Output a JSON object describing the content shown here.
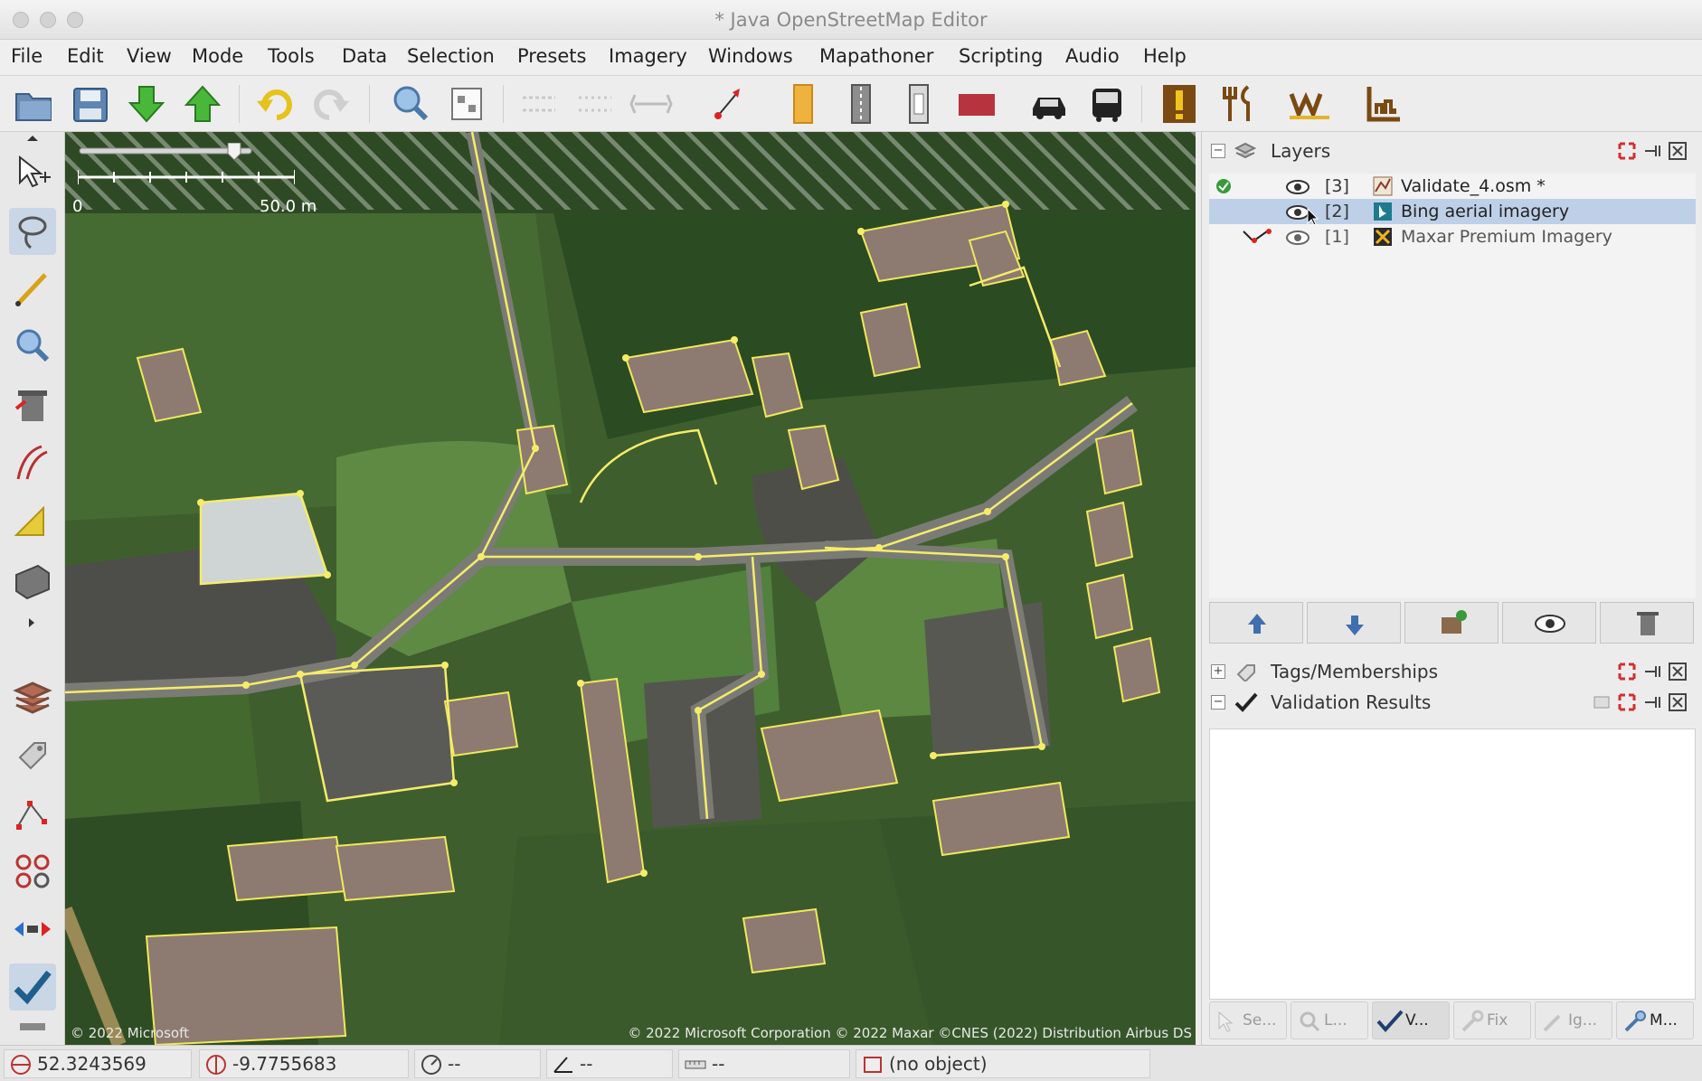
{
  "window": {
    "title": "* Java OpenStreetMap Editor"
  },
  "menu": [
    "File",
    "Edit",
    "View",
    "Mode",
    "Tools",
    "Data",
    "Selection",
    "Presets",
    "Imagery",
    "Windows",
    "Mapathoner",
    "Scripting",
    "Audio",
    "Help"
  ],
  "toolbar": {
    "icons": [
      "open-icon",
      "save-icon",
      "download-icon",
      "upload-icon",
      "undo-icon",
      "redo-icon",
      "zoom-icon",
      "select-box-icon",
      "align-icon",
      "align2-icon",
      "distribute-icon",
      "reverse-icon",
      "building-preset-icon",
      "road-preset-icon",
      "path-preset-icon",
      "parking-preset-icon",
      "car-icon",
      "bus-icon",
      "warning-icon",
      "restaurant-icon",
      "wiki-icon",
      "landuse-icon"
    ]
  },
  "map": {
    "scale_zero": "0",
    "scale_label": "50.0 m",
    "zoom_level": 0.72,
    "attribution": "© 2022 Microsoft Corporation © 2022 Maxar ©CNES (2022) Distribution Airbus DS",
    "attribution_left": "© 2022 Microsoft"
  },
  "panels": {
    "layers": {
      "title": "Layers",
      "items": [
        {
          "index": "[3]",
          "name": "Validate_4.osm *",
          "selected": false
        },
        {
          "index": "[2]",
          "name": "Bing aerial imagery",
          "selected": true
        },
        {
          "index": "[1]",
          "name": "Maxar Premium Imagery",
          "selected": false
        }
      ],
      "buttons": [
        "move-up-icon",
        "move-down-icon",
        "merge-icon",
        "visibility-icon",
        "delete-icon"
      ]
    },
    "tags": {
      "title": "Tags/Memberships"
    },
    "validation": {
      "title": "Validation Results"
    },
    "bottom_tabs": [
      {
        "label": "Se...",
        "icon": "select-icon",
        "active": false
      },
      {
        "label": "L...",
        "icon": "lookup-icon",
        "active": false
      },
      {
        "label": "V...",
        "icon": "validate-icon",
        "active": true
      },
      {
        "label": "Fix",
        "icon": "fix-icon",
        "active": false
      },
      {
        "label": "Ig...",
        "icon": "ignore-icon",
        "active": false
      },
      {
        "label": "M...",
        "icon": "more-icon",
        "active": false
      }
    ]
  },
  "status": {
    "lat": "52.3243569",
    "lon": "-9.7755683",
    "heading": "--",
    "angle": "--",
    "length": "--",
    "object": "(no object)"
  }
}
